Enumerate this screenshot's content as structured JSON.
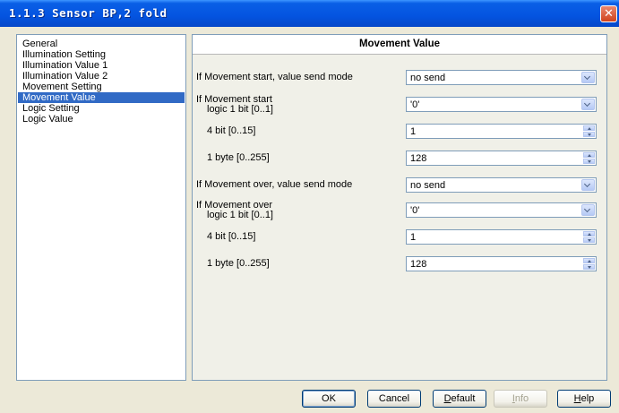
{
  "window": {
    "title": "1.1.3 Sensor BP,2 fold",
    "close_glyph": "✕"
  },
  "nav": {
    "items": [
      {
        "label": "General",
        "selected": false
      },
      {
        "label": "Illumination Setting",
        "selected": false
      },
      {
        "label": "Illumination Value 1",
        "selected": false
      },
      {
        "label": "Illumination Value 2",
        "selected": false
      },
      {
        "label": "Movement Setting",
        "selected": false
      },
      {
        "label": "Movement Value",
        "selected": true
      },
      {
        "label": "Logic Setting",
        "selected": false
      },
      {
        "label": "Logic Value",
        "selected": false
      }
    ]
  },
  "panel": {
    "title": "Movement Value",
    "start": {
      "send_mode_label": "If Movement start, value send mode",
      "send_mode_value": "no send",
      "logic_label_1": "If Movement start",
      "logic_label_2": "logic 1 bit [0..1]",
      "logic_value": "'0'",
      "bit4_label": "4 bit [0..15]",
      "bit4_value": "1",
      "byte1_label": "1 byte [0..255]",
      "byte1_value": "128"
    },
    "over": {
      "send_mode_label": "If Movement over, value send mode",
      "send_mode_value": "no send",
      "logic_label_1": "If Movement over",
      "logic_label_2": "logic 1 bit [0..1]",
      "logic_value": "'0'",
      "bit4_label": "4 bit [0..15]",
      "bit4_value": "1",
      "byte1_label": "1 byte [0..255]",
      "byte1_value": "128"
    }
  },
  "buttons": {
    "ok": "OK",
    "cancel": "Cancel",
    "default_first": "D",
    "default_rest": "efault",
    "info_first": "I",
    "info_rest": "nfo",
    "help_first": "H",
    "help_rest": "elp"
  },
  "colors": {
    "titlebar": "#0454e0",
    "selection": "#316ac5",
    "close_button": "#d1431c",
    "border": "#7f9db9",
    "window_bg": "#ece9d8"
  },
  "icons": {
    "close": "close-icon",
    "dropdown": "chevron-down-icon",
    "spin_up": "spin-up-icon",
    "spin_down": "spin-down-icon"
  }
}
